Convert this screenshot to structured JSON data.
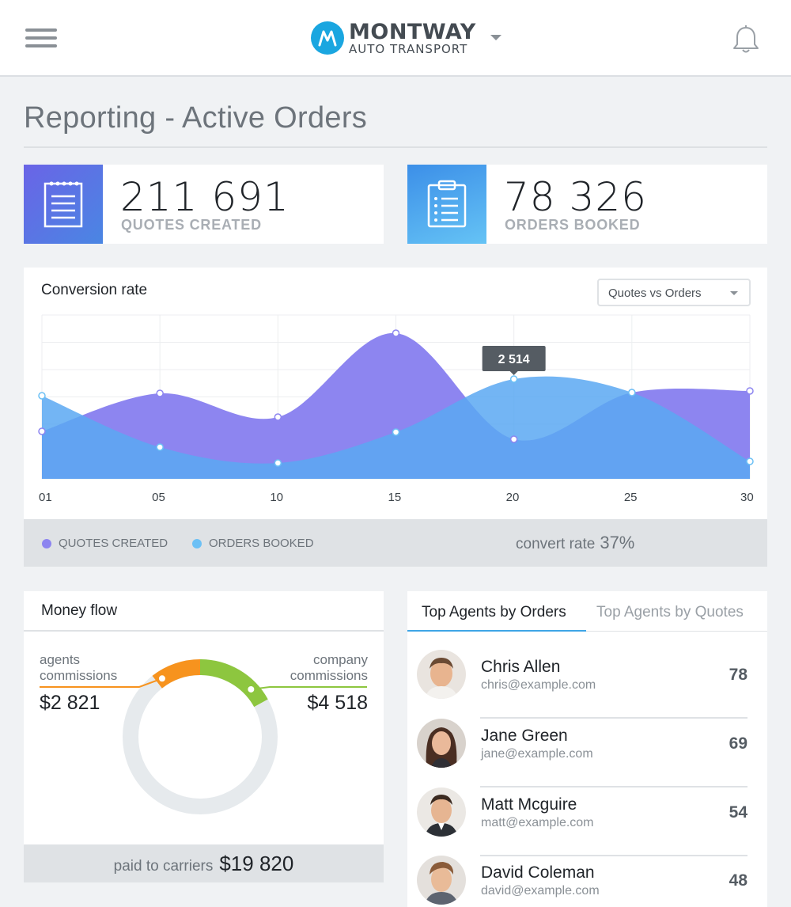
{
  "header": {
    "logo_title": "MONTWAY",
    "logo_subtitle": "AUTO TRANSPORT"
  },
  "page": {
    "title": "Reporting - Active Orders"
  },
  "stats": [
    {
      "value": "211 691",
      "label": "QUOTES CREATED",
      "color_from": "#6a64e6",
      "color_to": "#4a86e3"
    },
    {
      "value": "78 326",
      "label": "ORDERS BOOKED",
      "color_from": "#3c8fe8",
      "color_to": "#65c3f5"
    }
  ],
  "conversion": {
    "title": "Conversion rate",
    "select_value": "Quotes vs Orders",
    "legend": [
      {
        "label": "QUOTES CREATED",
        "color": "#8d85f0"
      },
      {
        "label": "ORDERS BOOKED",
        "color": "#6cc0f5"
      }
    ],
    "convert_label": "convert rate",
    "convert_value": "37%"
  },
  "chart_data": {
    "type": "area",
    "x": [
      "01",
      "05",
      "10",
      "15",
      "20",
      "25",
      "30"
    ],
    "series": [
      {
        "name": "QUOTES CREATED",
        "values": [
          60,
          108,
          78,
          184,
          50,
          109,
          111
        ],
        "color": "#8d85f0"
      },
      {
        "name": "ORDERS BOOKED",
        "values": [
          105,
          40,
          20,
          59,
          126,
          109,
          22
        ],
        "color": "#6cc0f5"
      }
    ],
    "tooltip": {
      "x": "20",
      "text": "2 514"
    },
    "ylim": [
      0,
      207
    ],
    "grid": true
  },
  "money": {
    "title": "Money flow",
    "agents_label": "agents commissions",
    "agents_value": "$2 821",
    "company_label": "company commissions",
    "company_value": "$4 518",
    "carriers_label": "paid to carriers",
    "carriers_value": "$19 820",
    "donut": {
      "agents_fraction": 0.1058,
      "company_fraction": 0.1694,
      "carriers_fraction": 0.7432,
      "agents_color": "#f7931e",
      "company_color": "#8dc63f",
      "carriers_color": "#e6eaed"
    }
  },
  "agents": {
    "tab_active": "Top Agents by Orders",
    "tab_inactive": "Top Agents by Quotes",
    "list": [
      {
        "name": "Chris Allen",
        "email": "chris@example.com",
        "count": "78"
      },
      {
        "name": "Jane Green",
        "email": "jane@example.com",
        "count": "69"
      },
      {
        "name": "Matt Mcguire",
        "email": "matt@example.com",
        "count": "54"
      },
      {
        "name": "David Coleman",
        "email": "david@example.com",
        "count": "48"
      }
    ]
  }
}
